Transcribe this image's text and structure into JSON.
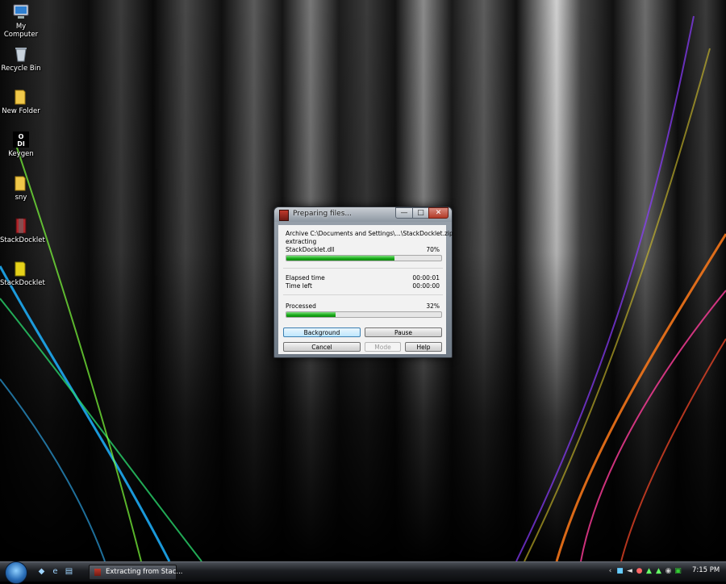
{
  "desktop": {
    "icons": [
      {
        "label": "My Computer",
        "icon": "computer-icon"
      },
      {
        "label": "Recycle Bin",
        "icon": "recycle-bin-icon"
      },
      {
        "label": "New Folder",
        "icon": "folder-icon"
      },
      {
        "label": "Keygen",
        "icon": "keygen-icon"
      },
      {
        "label": "sny",
        "icon": "folder-icon"
      },
      {
        "label": "StackDocklet",
        "icon": "archive-icon"
      },
      {
        "label": "StackDocklet",
        "icon": "folder-icon"
      }
    ]
  },
  "dialog": {
    "title": "Preparing files...",
    "archive_line": "Archive C:\\Documents and Settings\\...\\StackDocklet.zip",
    "action": "extracting",
    "current_file": "StackDocklet.dll",
    "file_percent_label": "70%",
    "file_progress": 0.7,
    "elapsed_label": "Elapsed time",
    "elapsed_value": "00:00:01",
    "time_left_label": "Time left",
    "time_left_value": "00:00:00",
    "processed_label": "Processed",
    "processed_percent_label": "32%",
    "processed_progress": 0.32,
    "buttons": {
      "background": "Background",
      "pause": "Pause",
      "cancel": "Cancel",
      "mode": "Mode",
      "help": "Help"
    },
    "window_controls": {
      "minimize": "—",
      "maximize": "□",
      "close": "✕"
    }
  },
  "taskbar": {
    "task_label": "Extracting from Stac...",
    "clock": "7:15 PM"
  },
  "colors": {
    "progress_green": "#16a816",
    "focused_button": "#bee6fd"
  }
}
